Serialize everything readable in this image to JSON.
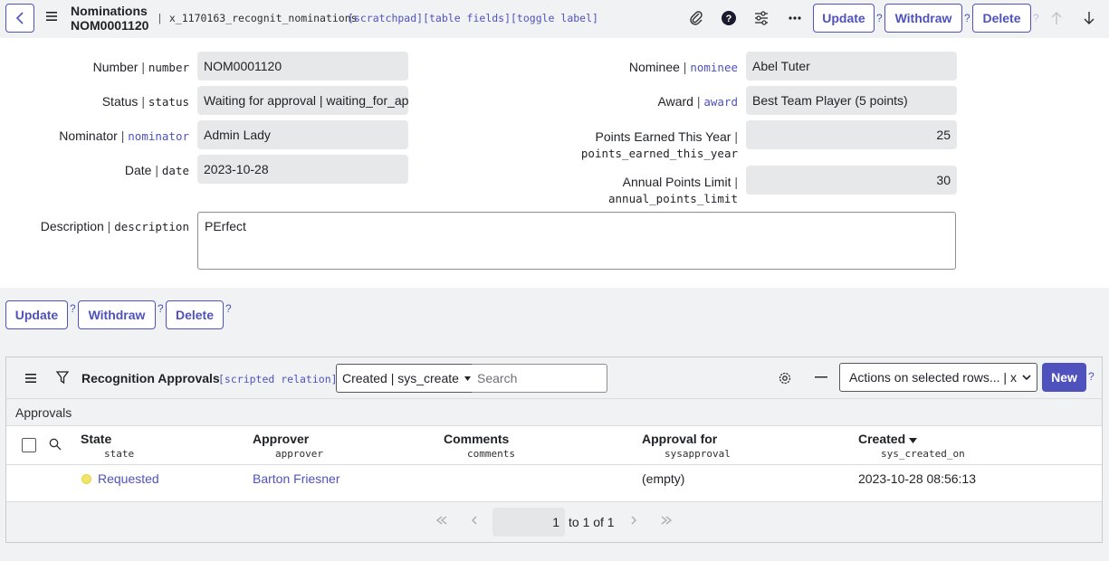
{
  "header": {
    "title": "Nominations",
    "number": "NOM0001120",
    "table_name": "x_1170163_recognit_nominations",
    "links": "[scratchpad][table fields][toggle label]",
    "update_label": "Update",
    "withdraw_label": "Withdraw",
    "delete_label": "Delete",
    "help_mark": "?"
  },
  "form": {
    "number": {
      "label": "Number",
      "field": "number",
      "value": "NOM0001120"
    },
    "status": {
      "label": "Status",
      "field": "status",
      "value": "Waiting for approval | waiting_for_approval"
    },
    "nominator": {
      "label": "Nominator",
      "field": "nominator",
      "value": "Admin Lady"
    },
    "date": {
      "label": "Date",
      "field": "date",
      "value": "2023-10-28"
    },
    "nominee": {
      "label": "Nominee",
      "field": "nominee",
      "value": "Abel Tuter"
    },
    "award": {
      "label": "Award",
      "field": "award",
      "value": "Best Team Player (5 points)"
    },
    "points_earned": {
      "label": "Points Earned This Year",
      "field": "points_earned_this_year",
      "value": "25"
    },
    "annual_limit": {
      "label": "Annual Points Limit",
      "field": "annual_points_limit",
      "value": "30"
    },
    "description": {
      "label": "Description",
      "field": "description",
      "value": "PErfect"
    }
  },
  "bottom_buttons": {
    "update_label": "Update",
    "withdraw_label": "Withdraw",
    "delete_label": "Delete"
  },
  "related_list": {
    "title": "Recognition Approvals",
    "scripted": "[scripted relation]",
    "sort_select": "Created | sys_create",
    "search_placeholder": "Search",
    "actions_select": "Actions on selected rows... | x",
    "new_label": "New",
    "section_label": "Approvals",
    "columns": [
      {
        "label": "State",
        "field": "state"
      },
      {
        "label": "Approver",
        "field": "approver"
      },
      {
        "label": "Comments",
        "field": "comments"
      },
      {
        "label": "Approval for",
        "field": "sysapproval"
      },
      {
        "label": "Created",
        "field": "sys_created_on"
      }
    ],
    "rows": [
      {
        "state": "Requested",
        "approver": "Barton Friesner",
        "comments": "",
        "approval_for": "(empty)",
        "created": "2023-10-28 08:56:13"
      }
    ],
    "state_dot_color": "#f2e36b",
    "pagination": {
      "current": "1",
      "of_text": "to 1 of 1"
    }
  },
  "colors": {
    "accent": "#4f52bd",
    "field_bg": "#e6e8ea",
    "page_bg": "#f1f2f3"
  }
}
